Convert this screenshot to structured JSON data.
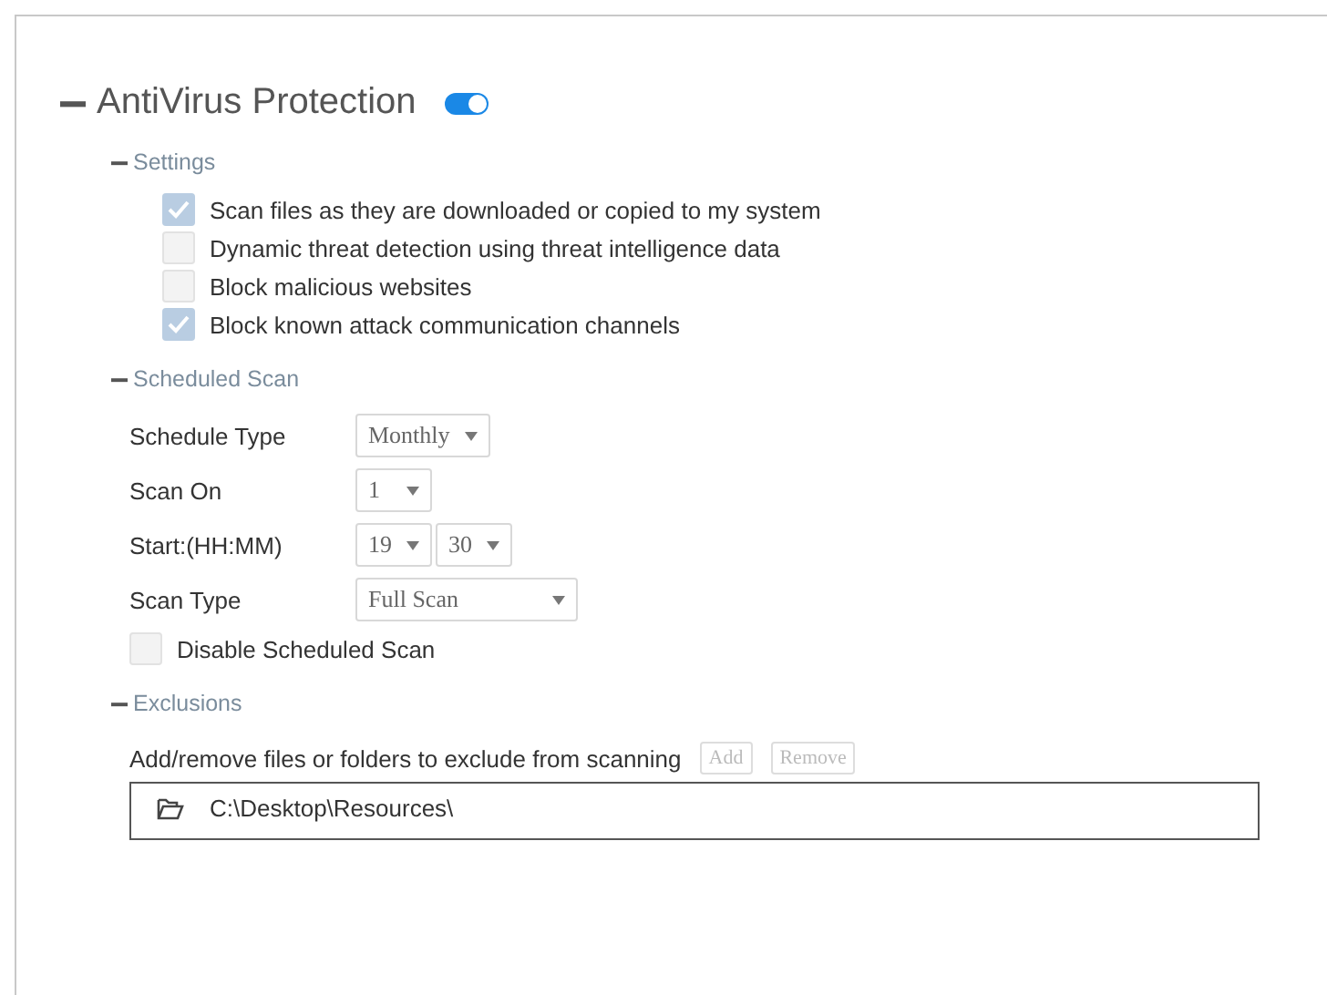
{
  "section": {
    "title": "AntiVirus Protection",
    "expanded": true,
    "enabled": true
  },
  "settings": {
    "title": "Settings",
    "expanded": true,
    "options": [
      {
        "label": "Scan files as they are downloaded or copied to my system",
        "checked": true
      },
      {
        "label": "Dynamic threat detection using threat intelligence data",
        "checked": false
      },
      {
        "label": "Block malicious websites",
        "checked": false
      },
      {
        "label": "Block known attack communication channels",
        "checked": true
      }
    ]
  },
  "scheduled_scan": {
    "title": "Scheduled Scan",
    "expanded": true,
    "fields": [
      {
        "label": "Schedule Type",
        "selects": [
          "Monthly"
        ]
      },
      {
        "label": "Scan On",
        "selects": [
          "1"
        ]
      },
      {
        "label": "Start:(HH:MM)",
        "selects": [
          "19",
          "30"
        ]
      },
      {
        "label": "Scan Type",
        "selects": [
          "Full Scan"
        ]
      }
    ],
    "disable_option": {
      "label": "Disable Scheduled Scan",
      "checked": false
    }
  },
  "exclusions": {
    "title": "Exclusions",
    "expanded": true,
    "instruction": "Add/remove files or folders to exclude from scanning",
    "buttons": [
      {
        "label": "Add",
        "disabled": true
      },
      {
        "label": "Remove",
        "disabled": true
      }
    ],
    "paths": [
      "C:\\Desktop\\Resources\\"
    ]
  }
}
